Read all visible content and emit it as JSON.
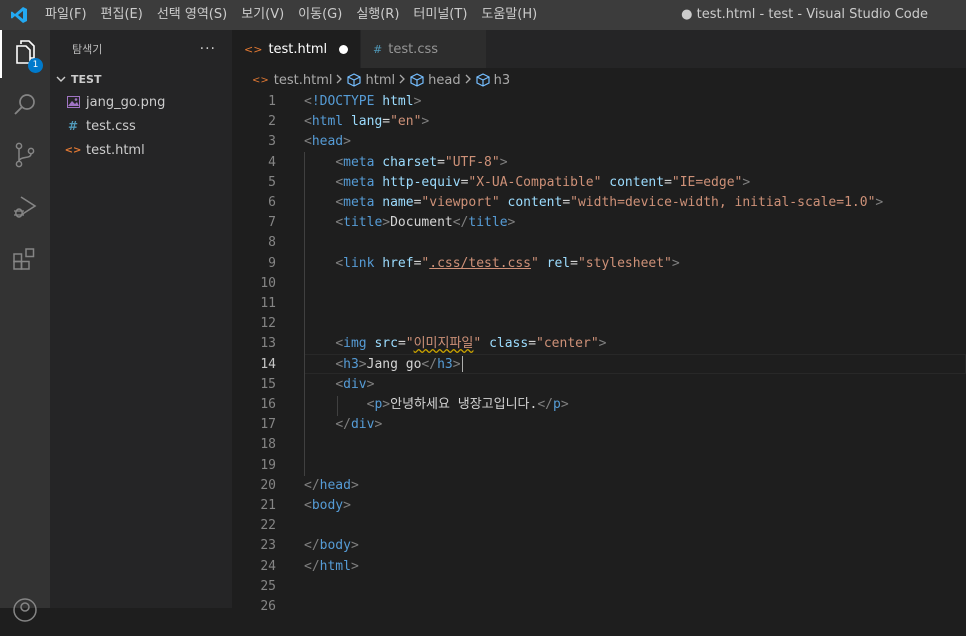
{
  "titlebar": {
    "menu": [
      "파일(F)",
      "편집(E)",
      "선택 영역(S)",
      "보기(V)",
      "이동(G)",
      "실행(R)",
      "터미널(T)",
      "도움말(H)"
    ],
    "window_title": "● test.html - test - Visual Studio Code"
  },
  "activitybar": {
    "explorer_badge": "1",
    "icons": [
      "files-icon",
      "search-icon",
      "source-control-icon",
      "run-debug-icon",
      "extensions-icon",
      "account-icon"
    ]
  },
  "sidebar": {
    "title": "탐색기",
    "more": "···",
    "folder": "TEST",
    "files": [
      {
        "name": "jang_go.png",
        "icon": "image-file-icon",
        "color": "#a074c4"
      },
      {
        "name": "test.css",
        "icon": "css-file-icon",
        "glyph": "#",
        "color": "#519aba"
      },
      {
        "name": "test.html",
        "icon": "html-file-icon",
        "glyph": "<>",
        "color": "#e37933"
      }
    ]
  },
  "tabs": [
    {
      "label": "test.html",
      "glyph": "<>",
      "active": true,
      "dirty": true
    },
    {
      "label": "test.css",
      "glyph": "#",
      "active": false,
      "dirty": false
    }
  ],
  "breadcrumbs": {
    "file": "test.html",
    "items": [
      "html",
      "head",
      "h3"
    ]
  },
  "editor": {
    "current_line": 14,
    "line_numbers": [
      "1",
      "2",
      "3",
      "4",
      "5",
      "6",
      "7",
      "8",
      "9",
      "10",
      "11",
      "12",
      "13",
      "14",
      "15",
      "16",
      "17",
      "18",
      "19",
      "20",
      "21",
      "22",
      "23",
      "24",
      "25",
      "26"
    ],
    "lines": [
      "<!DOCTYPE html>",
      "<html lang=\"en\">",
      "<head>",
      "    <meta charset=\"UTF-8\">",
      "    <meta http-equiv=\"X-UA-Compatible\" content=\"IE=edge\">",
      "    <meta name=\"viewport\" content=\"width=device-width, initial-scale=1.0\">",
      "    <title>Document</title>",
      "",
      "    <link href=\".css/test.css\" rel=\"stylesheet\">",
      "",
      "",
      "",
      "    <img src=\"이미지파일\" class=\"center\">",
      "    <h3>Jang go</h3>",
      "    <div>",
      "        <p>안녕하세요 냉장고입니다.</p>",
      "    </div>",
      "",
      "",
      "</head>",
      "<body>",
      "",
      "</body>",
      "</html>",
      "",
      ""
    ]
  },
  "colors": {
    "tag": "#569cd6",
    "bracket": "#808080",
    "attribute": "#9cdcfe",
    "string": "#ce9178",
    "text": "#d4d4d4",
    "accent": "#007acc"
  }
}
